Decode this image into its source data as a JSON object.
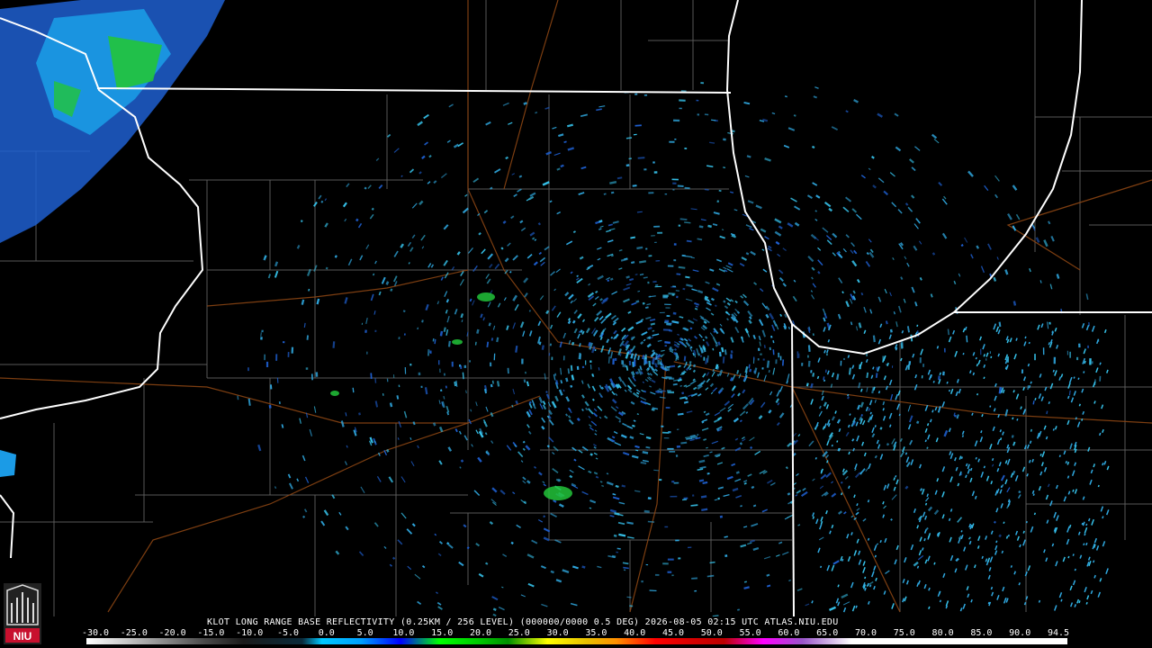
{
  "caption": "KLOT LONG RANGE BASE REFLECTIVITY (0.25KM / 256 LEVEL) (000000/0000 0.5 DEG) 2026-08-05 02:15 UTC  ATLAS.NIU.EDU",
  "scale": {
    "labels": [
      "-30.0",
      "-25.0",
      "-20.0",
      "-15.0",
      "-10.0",
      "-5.0",
      "0.0",
      "5.0",
      "10.0",
      "15.0",
      "20.0",
      "25.0",
      "30.0",
      "35.0",
      "40.0",
      "45.0",
      "50.0",
      "55.0",
      "60.0",
      "65.0",
      "70.0",
      "75.0",
      "80.0",
      "85.0",
      "90.0",
      "94.5"
    ]
  },
  "logo": {
    "text": "NIU",
    "color": "#c8102e"
  },
  "colors": {
    "background": "#000000",
    "state_border": "#ffffff",
    "county_border": "#7a7a7a",
    "roads": "#8b4513",
    "echo_light": "#2fa8e0",
    "echo_mid": "#1e5fd0",
    "echo_green": "#22c43a"
  },
  "icons": {
    "radar_site": "radar-site-dot-icon",
    "logo": "niu-logo-icon"
  }
}
